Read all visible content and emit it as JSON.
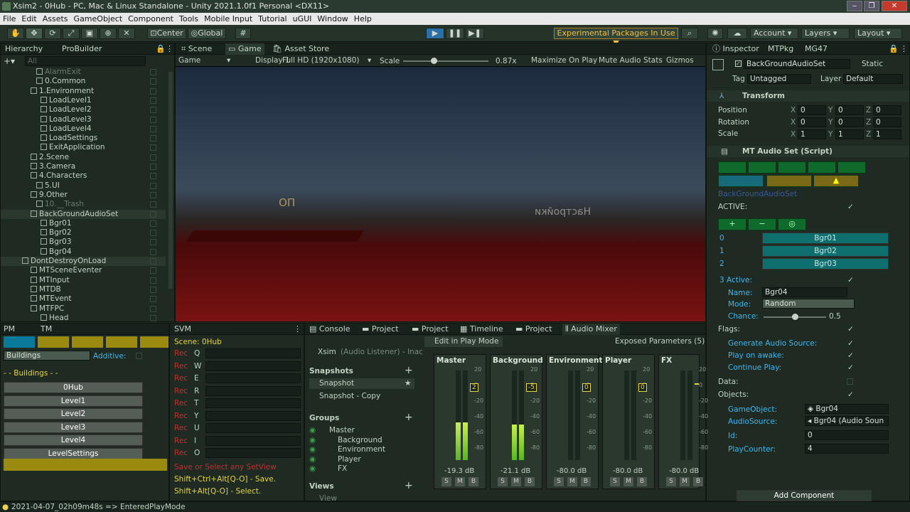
{
  "window": {
    "title": "Xsim2 - 0Hub - PC, Mac & Linux Standalone - Unity 2021.1.0f1 Personal <DX11>"
  },
  "menu": [
    "File",
    "Edit",
    "Assets",
    "GameObject",
    "Component",
    "Tools",
    "Mobile Input",
    "Tutorial",
    "uGUI",
    "Window",
    "Help"
  ],
  "toolbar": {
    "center": "Center",
    "global": "Global",
    "experimental": "Experimental Packages In Use ▼",
    "account": "Account",
    "layers": "Layers",
    "layout": "Layout"
  },
  "hierarchy": {
    "tabs": [
      "Hierarchy",
      "ProBuilder"
    ],
    "search_placeholder": "All",
    "rows": [
      "AlarmExit",
      "0.Common",
      "1.Environment",
      "LoadLevel1",
      "LoadLevel2",
      "LoadLevel3",
      "LoadLevel4",
      "LoadSettings",
      "ExitApplication",
      "2.Scene",
      "3.Camera",
      "4.Characters",
      "5.UI",
      "9.Other",
      "10.__Trash",
      "BackGroundAudioSet",
      "Bgr01",
      "Bgr02",
      "Bgr03",
      "Bgr04",
      "DontDestroyOnLoad",
      "MTSceneEventer",
      "MTInput",
      "MTDB",
      "MTEvent",
      "MTFPC",
      "Head"
    ]
  },
  "scene_tabs": [
    "Scene",
    "Game",
    "Asset Store"
  ],
  "game_bar": {
    "mode": "Game",
    "display": "Display 1",
    "res": "Full HD (1920x1080)",
    "scale_label": "Scale",
    "scale_value": "0.87x",
    "scale_fraction": 0.36,
    "maximize": "Maximize On Play",
    "mute": "Mute Audio",
    "stats": "Stats",
    "gizmos": "Gizmos"
  },
  "game_view": {
    "sign_text": "Настройки",
    "small_sign": "ПО"
  },
  "pm": {
    "tabs": [
      "PM",
      "TM"
    ],
    "dropdown": "Buildings",
    "additive": "Additive:",
    "header": "- - Buildings - -",
    "buttons": [
      "0Hub",
      "Level1",
      "Level2",
      "Level3",
      "Level4",
      "LevelSettings"
    ]
  },
  "svm": {
    "tab": "SVM",
    "scene": "Scene: 0Hub",
    "keys": [
      "Q",
      "W",
      "E",
      "R",
      "T",
      "Y",
      "U",
      "I",
      "O"
    ],
    "rec": "Rec",
    "hint1": "Save or Select any SetView",
    "hint2": "Shift+Ctrl+Alt[Q-O] - Save.",
    "hint3": "Shift+Alt[Q-O] - Select."
  },
  "mixer": {
    "tabs": [
      "Console",
      "Project",
      "Project",
      "Timeline",
      "Project",
      "Audio Mixer"
    ],
    "edit_play": "Edit in Play Mode",
    "exposed": "Exposed Parameters (5)",
    "xsim": "Xsim",
    "listener": "(Audio Listener) - Inac",
    "snapshots_h": "Snapshots",
    "snapshots": [
      "Snapshot",
      "Snapshot - Copy"
    ],
    "groups_h": "Groups",
    "groups": [
      "Master",
      "Background",
      "Environment",
      "Player",
      "FX"
    ],
    "views_h": "Views",
    "views": [
      "View"
    ],
    "channels": [
      {
        "name": "Master",
        "db": "-19.3 dB",
        "level": 0.42
      },
      {
        "name": "Background",
        "db": "-21.1 dB",
        "level": 0.4
      },
      {
        "name": "Environment",
        "db": "-80.0 dB",
        "level": 0.0
      },
      {
        "name": "Player",
        "db": "-80.0 dB",
        "level": 0.0
      },
      {
        "name": "FX",
        "db": "-80.0 dB",
        "level": 0.0
      }
    ],
    "scale": [
      "20",
      "0",
      "-20",
      "-40",
      "-60",
      "-80"
    ],
    "fader_vals": [
      "2",
      "-5",
      "0",
      "0",
      ""
    ]
  },
  "inspector": {
    "tabs": [
      "Inspector",
      "MTPkg",
      "MG47"
    ],
    "object": "BackGroundAudioSet",
    "static": "Static",
    "tag_label": "Tag",
    "tag": "Untagged",
    "layer_label": "Layer",
    "layer": "Default",
    "transform": "Transform",
    "position": "Position",
    "rotation": "Rotation",
    "scale": "Scale",
    "pos": [
      "0",
      "0",
      "0"
    ],
    "rot": [
      "0",
      "0",
      "0"
    ],
    "scl": [
      "1",
      "1",
      "1"
    ],
    "script": "MT Audio Set (Script)",
    "set_name": "BackGroundAudioSet",
    "active_label": "ACTIVE:",
    "items": [
      "Bgr01",
      "Bgr02",
      "Bgr03"
    ],
    "item_idx": [
      "0",
      "1",
      "2"
    ],
    "cur_idx": "3",
    "cur_active": "Active:",
    "name_label": "Name:",
    "name_value": "Bgr04",
    "mode_label": "Mode:",
    "mode_value": "Random",
    "chance_label": "Chance:",
    "chance_value": "0.5",
    "chance_fraction": 0.5,
    "flags_label": "Flags:",
    "gen_src": "Generate Audio Source:",
    "play_awake": "Play on awake:",
    "continue": "Continue Play:",
    "data_label": "Data:",
    "objects_label": "Objects:",
    "go_label": "GameObject:",
    "go_value": "Bgr04",
    "as_label": "AudioSource:",
    "as_value": "Bgr04 (Audio Soun",
    "id_label": "Id:",
    "id_value": "0",
    "pc_label": "PlayCounter:",
    "pc_value": "4",
    "add_component": "Add Component"
  },
  "status": "2021-04-07_02h09m48s => EnteredPlayMode"
}
